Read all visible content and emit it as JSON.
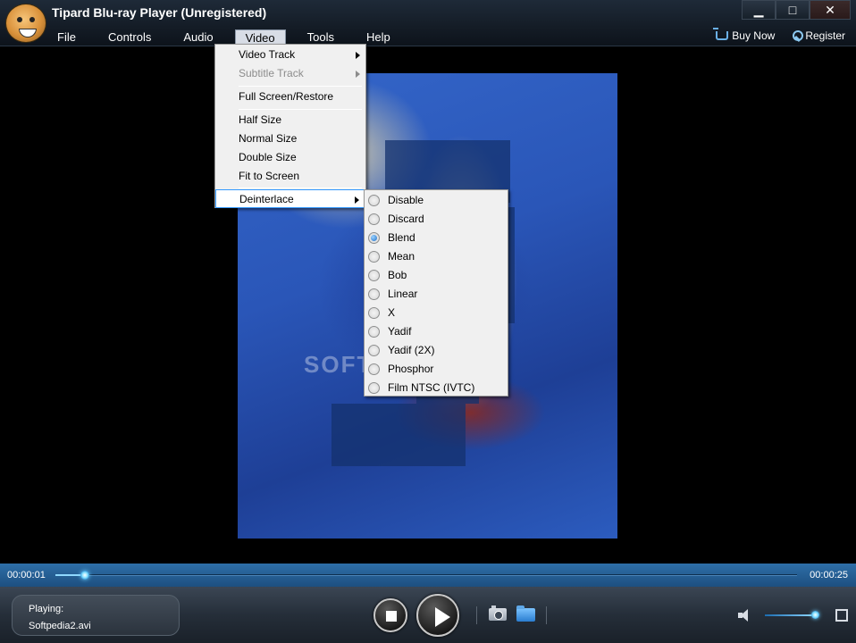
{
  "window": {
    "title": "Tipard Blu-ray Player (Unregistered)",
    "minimize_glyph": "▁",
    "maximize_glyph": "□",
    "close_glyph": "✕"
  },
  "menubar": {
    "items": [
      "File",
      "Controls",
      "Audio",
      "Video",
      "Tools",
      "Help"
    ],
    "active": "Video"
  },
  "header_links": {
    "buy_now": "Buy Now",
    "register": "Register"
  },
  "video_menu": {
    "items": [
      {
        "label": "Video Track",
        "has_submenu": true,
        "enabled": true
      },
      {
        "label": "Subtitle Track",
        "has_submenu": true,
        "enabled": false
      },
      {
        "label": "Full Screen/Restore",
        "enabled": true
      },
      {
        "label": "Half Size",
        "enabled": true
      },
      {
        "label": "Normal Size",
        "enabled": true
      },
      {
        "label": "Double Size",
        "enabled": true
      },
      {
        "label": "Fit to Screen",
        "enabled": true
      },
      {
        "label": "Deinterlace",
        "has_submenu": true,
        "enabled": true,
        "highlighted": true
      }
    ]
  },
  "deinterlace_submenu": {
    "options": [
      "Disable",
      "Discard",
      "Blend",
      "Mean",
      "Bob",
      "Linear",
      "X",
      "Yadif",
      "Yadif (2X)",
      "Phosphor",
      "Film NTSC (IVTC)"
    ],
    "selected": "Blend"
  },
  "video": {
    "watermark": "SOFTPEDIA"
  },
  "playback": {
    "current_time": "00:00:01",
    "total_time": "00:00:25",
    "progress": 0.04,
    "volume": 0.9
  },
  "now_playing": {
    "label": "Playing:",
    "file": "Softpedia2.avi"
  },
  "icons": {
    "logo": "tipard-cheetah-logo",
    "buy_now": "cart-icon",
    "register": "wrench-icon",
    "snapshot": "camera-icon",
    "open": "folder-icon",
    "volume": "speaker-icon",
    "fullscreen": "fullscreen-icon"
  },
  "colors": {
    "accent": "#1d4f80",
    "highlight_border": "#3399ff",
    "progress_glow": "#8ee4ff"
  }
}
